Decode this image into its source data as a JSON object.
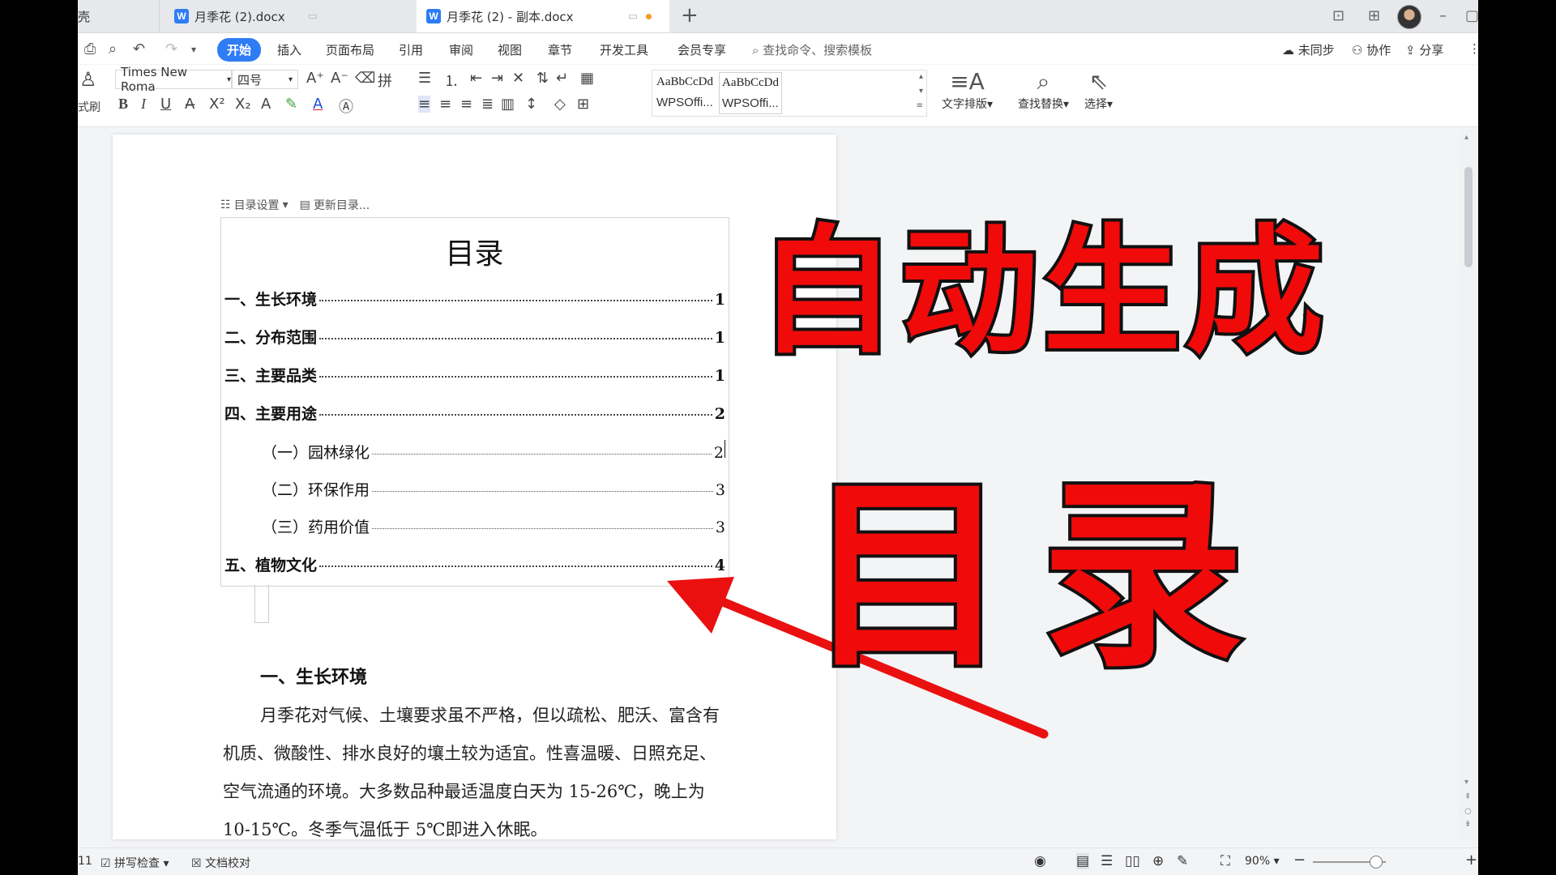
{
  "tabs": {
    "partial": "壳",
    "tab1": "月季花 (2).docx",
    "tab2": "月季花 (2) - 副本.docx"
  },
  "menu": {
    "start": "开始",
    "items": [
      "插入",
      "页面布局",
      "引用",
      "审阅",
      "视图",
      "章节",
      "开发工具",
      "会员专享"
    ],
    "search": "查找命令、搜索模板",
    "sync": "未同步",
    "collab": "协作",
    "share": "分享"
  },
  "ribbon": {
    "format_painter": "式刷",
    "font": "Times New Roma",
    "size": "四号",
    "style1_sample": "AaBbCcDd",
    "style1_name": "WPSOffi...",
    "style2_sample": "AaBbCcDd",
    "style2_name": "WPSOffi...",
    "text_layout": "文字排版",
    "find_replace": "查找替换",
    "select": "选择"
  },
  "toc": {
    "settings": "目录设置",
    "update": "更新目录...",
    "title": "目录",
    "entries": [
      {
        "text": "一、生长环境",
        "page": "1"
      },
      {
        "text": "二、分布范围",
        "page": "1"
      },
      {
        "text": "三、主要品类",
        "page": "1"
      },
      {
        "text": "四、主要用途",
        "page": "2"
      },
      {
        "text": "（一）园林绿化",
        "page": "2"
      },
      {
        "text": "（二）环保作用",
        "page": "3"
      },
      {
        "text": "（三）药用价值",
        "page": "3"
      },
      {
        "text": "五、植物文化",
        "page": "4"
      }
    ]
  },
  "doc": {
    "heading": "一、生长环境",
    "paragraph": "月季花对气候、土壤要求虽不严格，但以疏松、肥沃、富含有机质、微酸性、排水良好的壤土较为适宜。性喜温暖、日照充足、空气流通的环境。大多数品种最适温度白天为 15-26℃，晚上为 10-15℃。冬季气温低于 5℃即进入休眠。"
  },
  "status": {
    "page_count": "11",
    "spellcheck": "拼写检查",
    "proofread": "文档校对",
    "zoom": "90%"
  },
  "overlay": {
    "line1": "自动生成",
    "line2": "目录",
    "color": "#f00a0a"
  }
}
